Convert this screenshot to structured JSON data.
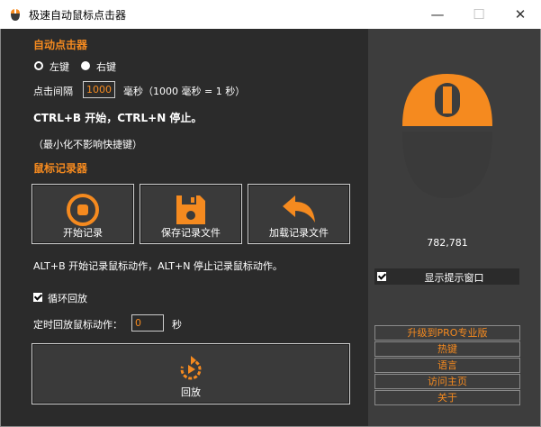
{
  "window": {
    "title": "极速自动鼠标点击器",
    "minimize_glyph": "—",
    "maximize_glyph": "☐",
    "close_glyph": "✕"
  },
  "clicker": {
    "section_title": "自动点击器",
    "left_key": "左键",
    "right_key": "右键",
    "selected": "左键",
    "interval_label": "点击间隔",
    "interval_value": "1000",
    "interval_unit": "毫秒（1000 毫秒 = 1 秒）",
    "hotkeys": "CTRL+B 开始，CTRL+N 停止。",
    "hint": "（最小化不影响快捷键）"
  },
  "recorder": {
    "section_title": "鼠标记录器",
    "start_label": "开始记录",
    "save_label": "保存记录文件",
    "load_label": "加载记录文件",
    "hotkeys": "ALT+B 开始记录鼠标动作，ALT+N 停止记录鼠标动作。",
    "loop_label": "循环回放",
    "loop_checked": true,
    "timer_label": "定时回放鼠标动作：",
    "timer_value": "0",
    "timer_unit": "秒",
    "playback_label": "回放"
  },
  "side": {
    "coords": "782,781",
    "show_tip_label": "显示提示窗口",
    "show_tip_checked": true,
    "links": {
      "upgrade": "升级到PRO专业版",
      "hotkeys": "热键",
      "language": "语言",
      "homepage": "访问主页",
      "about": "关于"
    }
  },
  "colors": {
    "accent": "#f58a1f",
    "panel_bg": "#2b2b2b",
    "side_bg": "#3d3d3d",
    "mouse_body": "#3a3a3a"
  },
  "icons": {
    "app": "mouse-icon",
    "start": "record-circle-icon",
    "save": "floppy-disk-icon",
    "load": "undo-arrow-icon",
    "playback": "replay-icon",
    "mouse_graphic": "mouse-icon"
  }
}
